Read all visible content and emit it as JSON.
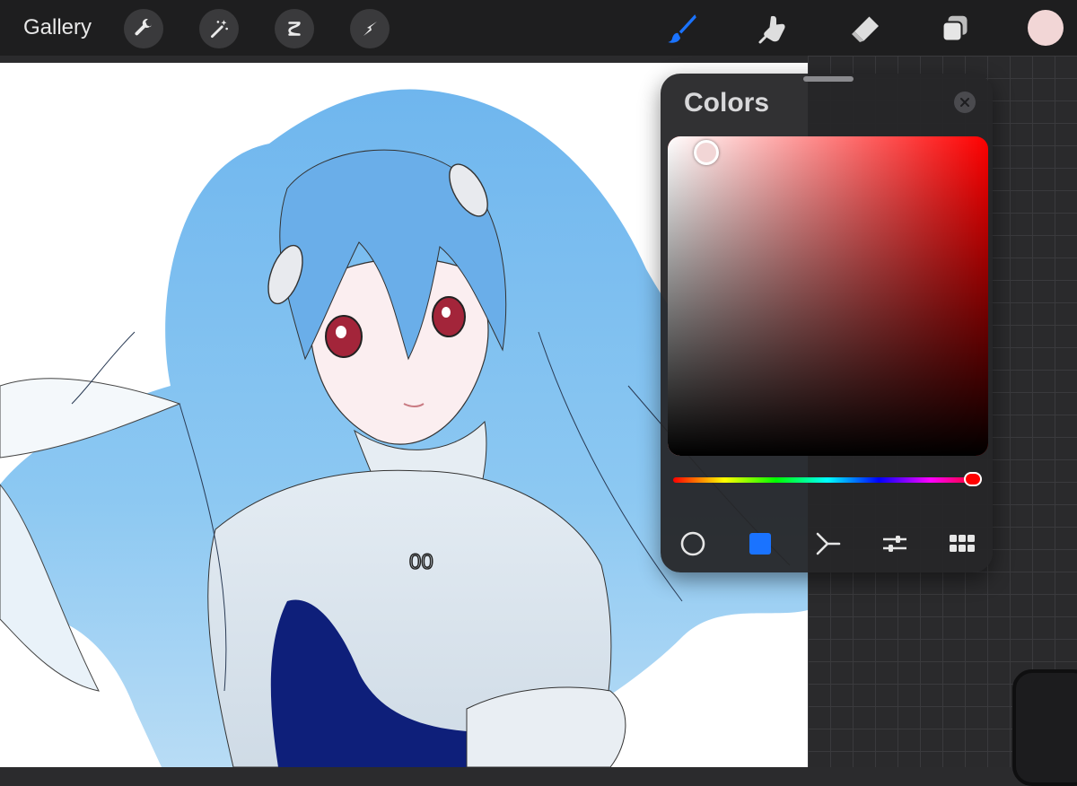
{
  "toolbar": {
    "gallery_label": "Gallery",
    "left_tools": [
      "wrench-icon",
      "magic-wand-icon",
      "selection-icon",
      "transform-arrow-icon"
    ],
    "right_tools": [
      "brush-icon",
      "smudge-icon",
      "eraser-icon",
      "layers-icon"
    ],
    "active_tool": "brush-icon",
    "current_color": "#f2d6d6"
  },
  "colors_panel": {
    "title": "Colors",
    "selected_color": "#f2d6d6",
    "hue_color": "#ff0000",
    "saturation": 0.12,
    "brightness": 0.95,
    "hue_position": 0.97,
    "tabs": [
      "disc-icon",
      "classic-square-icon",
      "harmony-icon",
      "value-sliders-icon",
      "palettes-icon"
    ],
    "active_tab": "classic-square-icon"
  },
  "canvas": {
    "artwork_label": "00"
  },
  "colors": {
    "accent_blue": "#1a73ff",
    "toolbar_bg": "#1e1e1f",
    "panel_bg": "#262628"
  }
}
